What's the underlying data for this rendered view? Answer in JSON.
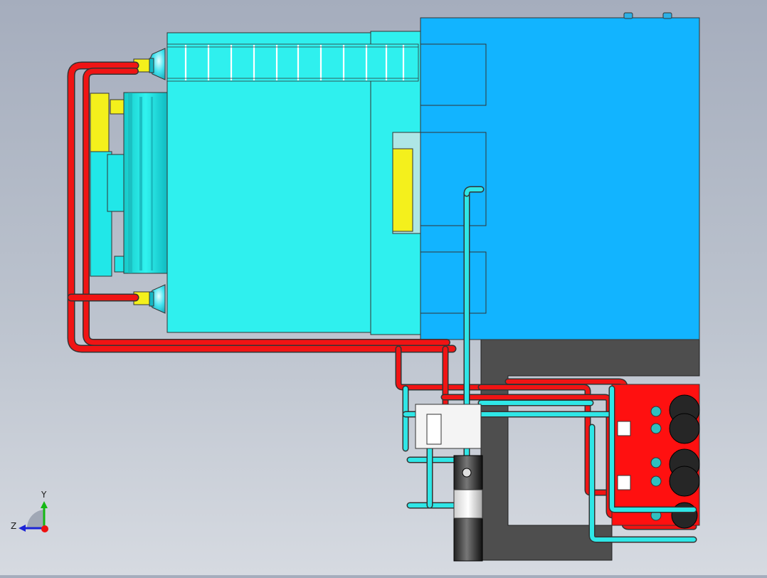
{
  "triad": {
    "y_label": "Y",
    "z_label": "Z"
  },
  "colors": {
    "cyan_body": "#2ff0ee",
    "blue_body": "#12b4ff",
    "hot_pipe": "#f01414",
    "cold_pipe": "#2fe6e6",
    "yellow_part": "#f4f01c",
    "dark_frame": "#4e4e4e",
    "manifold": "#ff1010"
  }
}
